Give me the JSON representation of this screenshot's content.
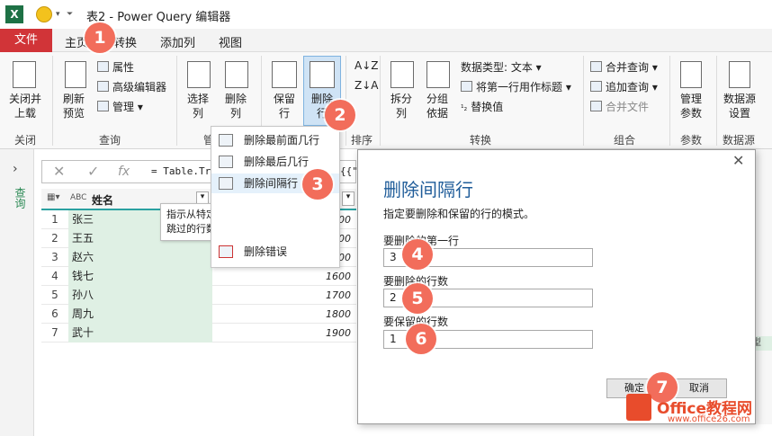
{
  "window": {
    "title": "表2 - Power Query 编辑器"
  },
  "menu": {
    "file": "文件",
    "home": "主页",
    "transform": "转换",
    "add_column": "添加列",
    "view": "视图"
  },
  "ribbon": {
    "close_upload": "关闭并\n上载",
    "close_arrow": "▾",
    "refresh_preview": "刷新\n预览",
    "properties": "属性",
    "advanced_editor": "高级编辑器",
    "manage": "管理",
    "choose_columns": "选择\n列",
    "remove_columns": "删除\n列",
    "keep_rows": "保留\n行",
    "remove_rows": "删除\n行",
    "split_column": "拆分\n列",
    "group_by": "分组\n依据",
    "data_type": "数据类型: 文本",
    "first_row_header": "将第一行用作标题",
    "replace_values": "替换值",
    "merge_queries": "合并查询",
    "append_queries": "追加查询",
    "combine_files": "合并文件",
    "manage_params": "管理\n参数",
    "data_source_settings": "数据源\n设置",
    "groups": {
      "close": "关闭",
      "query": "查询",
      "manage_cols": "管",
      "sort": "排序",
      "transform": "转换",
      "combine": "组合",
      "params": "参数",
      "datasource": "数据源"
    }
  },
  "dropdown": {
    "items": [
      "删除最前面几行",
      "删除最后几行",
      "删除间隔行",
      "删除错误"
    ]
  },
  "tooltip": {
    "text": "指示从特定行开始要重复取得和跳过的行数。"
  },
  "left_pane": {
    "label": "查询"
  },
  "formula": {
    "text": "= Table.Tr",
    "tail": "{{\""
  },
  "table": {
    "header": "姓名",
    "header_type": "ABC",
    "rows": [
      {
        "n": "1",
        "name": "张三",
        "value": "00"
      },
      {
        "n": "2",
        "name": "王五",
        "value": "00"
      },
      {
        "n": "3",
        "name": "赵六",
        "value": "00"
      },
      {
        "n": "4",
        "name": "钱七",
        "value": "1600"
      },
      {
        "n": "5",
        "name": "孙八",
        "value": "1700"
      },
      {
        "n": "6",
        "name": "周九",
        "value": "1800"
      },
      {
        "n": "7",
        "name": "武十",
        "value": "1900"
      }
    ]
  },
  "dialog": {
    "title": "删除间隔行",
    "description": "指定要删除和保留的行的模式。",
    "first_row_label": "要删除的第一行",
    "first_row_value": "3",
    "rows_remove_label": "要删除的行数",
    "rows_remove_value": "2",
    "rows_keep_label": "要保留的行数",
    "rows_keep_value": "1",
    "ok": "确定",
    "cancel": "取消"
  },
  "badges": [
    "1",
    "2",
    "3",
    "4",
    "5",
    "6",
    "7"
  ],
  "watermark": {
    "name": "Office教程网",
    "url": "www.office26.com"
  },
  "side_chip": "型",
  "colors": {
    "accent": "#1f5c99",
    "file_tab": "#d13438",
    "badge": "#f26d5b",
    "name_col": "#dff0e4"
  }
}
